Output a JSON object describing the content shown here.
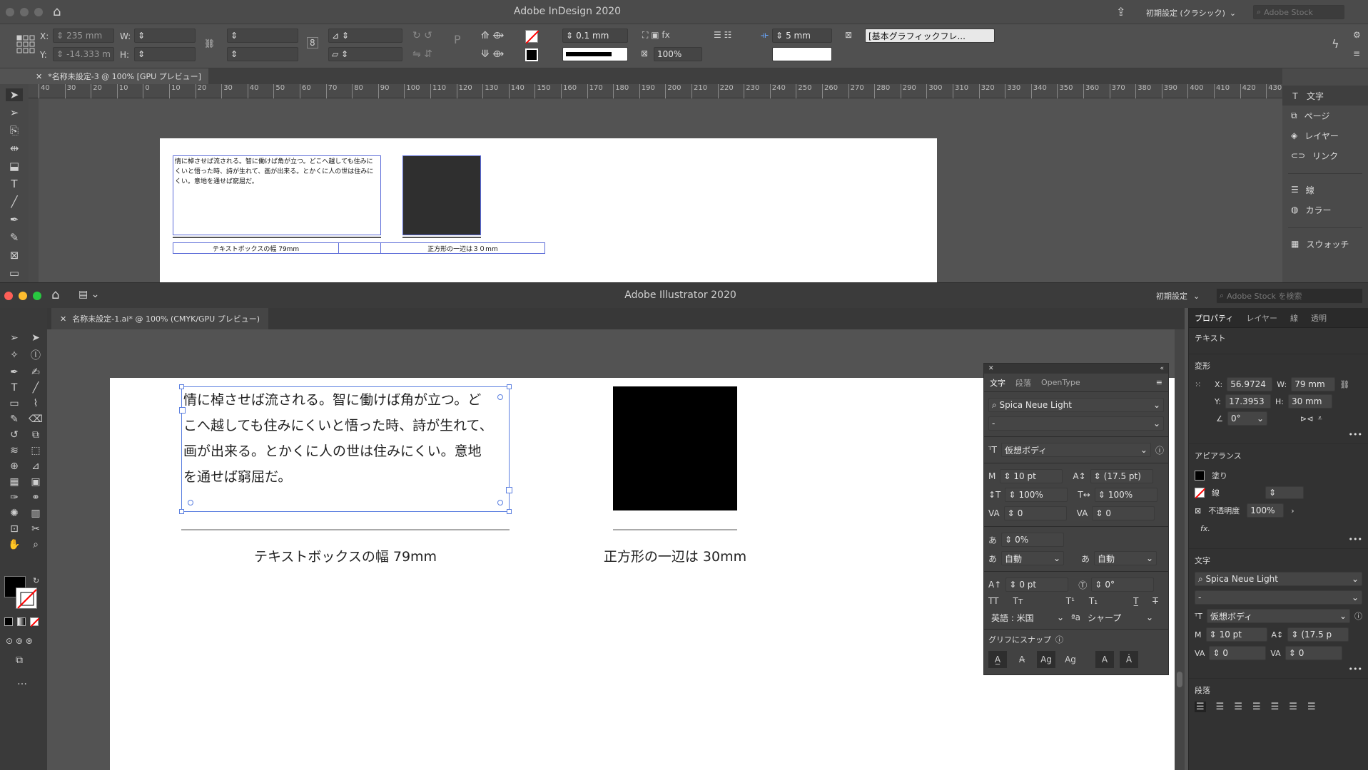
{
  "indesign": {
    "title": "Adobe InDesign 2020",
    "workspace": "初期設定 (クラシック)",
    "stock_placeholder": "Adobe Stock",
    "control": {
      "x_label": "X:",
      "x_value": "235 mm",
      "y_label": "Y:",
      "y_value": "-14.333 m",
      "w_label": "W:",
      "h_label": "H:",
      "stroke_weight": "0.1 mm",
      "scale": "100%",
      "gap": "5 mm",
      "frame_style": "[基本グラフィックフレ..."
    },
    "tab": "*名称未設定-3 @ 100% [GPU プレビュー]",
    "ruler_ticks": [
      "40",
      "30",
      "20",
      "10",
      "0",
      "10",
      "20",
      "30",
      "40",
      "50",
      "60",
      "70",
      "80",
      "90",
      "100",
      "110",
      "120",
      "130",
      "140",
      "150",
      "160",
      "170",
      "180",
      "190",
      "200",
      "210",
      "220",
      "230",
      "240",
      "250",
      "260",
      "270",
      "280",
      "290",
      "300",
      "310",
      "320",
      "330",
      "340",
      "350",
      "360",
      "370",
      "380",
      "390",
      "400",
      "410",
      "420",
      "430"
    ],
    "page_text": "情に棹させば流される。智に働けば角が立つ。どこへ越しても住みにくいと悟った時、詩が生れて、画が出来る。とかくに人の世は住みにくい。意地を通せば窮屈だ。",
    "caption_left": "テキストボックスの幅 79mm",
    "caption_right": "正方形の一辺は３０mm",
    "panels": [
      "文字",
      "ページ",
      "レイヤー",
      "リンク",
      "線",
      "カラー",
      "スウォッチ"
    ]
  },
  "illustrator": {
    "title": "Adobe Illustrator 2020",
    "workspace": "初期設定",
    "stock_placeholder": "Adobe Stock を検索",
    "tab": "名称未設定-1.ai* @ 100% (CMYK/GPU プレビュー)",
    "body_lines": [
      "情に棹させば流される。智に働けば角が立つ。ど",
      "こへ越しても住みにくいと悟った時、詩が生れて、",
      "画が出来る。とかくに人の世は住みにくい。意地",
      "を通せば窮屈だ。"
    ],
    "caption_left": "テキストボックスの幅 79mm",
    "caption_right": "正方形の一辺は 30mm",
    "char_panel": {
      "tabs": [
        "文字",
        "段落",
        "OpenType"
      ],
      "font": "Spica Neue Light",
      "style": "-",
      "kana": "仮想ボディ",
      "size": "10 pt",
      "leading": "(17.5 pt)",
      "vscale": "100%",
      "hscale": "100%",
      "kerning": "0",
      "tracking": "0",
      "tsume": "0%",
      "aki_left": "自動",
      "aki_right": "自動",
      "baseline": "0 pt",
      "rotate": "0°",
      "lang": "英語 : 米国",
      "aa": "シャープ",
      "snap": "グリフにスナップ"
    },
    "props": {
      "tabs": [
        "プロパティ",
        "レイヤー",
        "線",
        "透明"
      ],
      "section_text": "テキスト",
      "transform": "変形",
      "x_label": "X:",
      "x": "56.9724",
      "y_label": "Y:",
      "y": "17.3953",
      "w_label": "W:",
      "w": "79 mm",
      "h_label": "H:",
      "h": "30 mm",
      "angle": "0°",
      "appearance": "アピアランス",
      "fill": "塗り",
      "stroke": "線",
      "opacity_label": "不透明度",
      "opacity": "100%",
      "char": "文字",
      "font": "Spica Neue Light",
      "style": "-",
      "kana": "仮想ボディ",
      "size": "10 pt",
      "leading": "(17.5 p",
      "kern": "0",
      "track": "0",
      "para": "段落"
    }
  }
}
